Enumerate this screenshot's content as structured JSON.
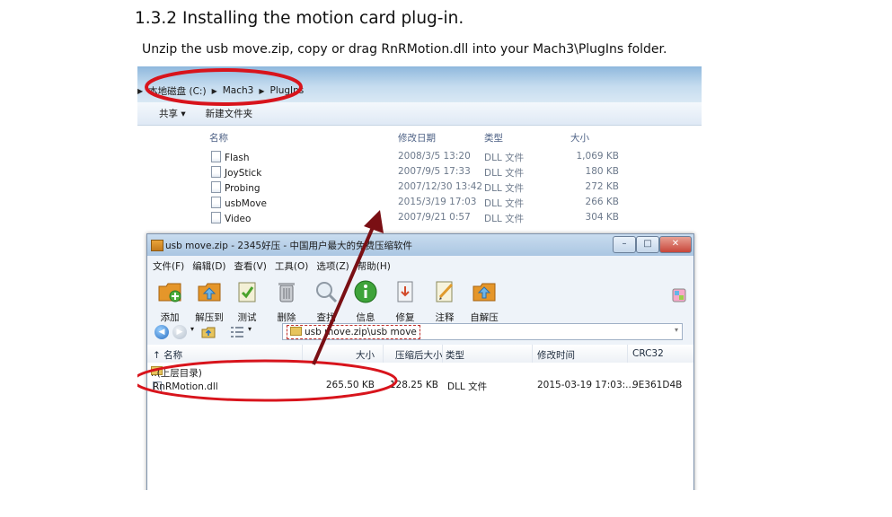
{
  "heading": "1.3.2 Installing the motion card plug-in.",
  "instruction": "Unzip the usb move.zip, copy or drag RnRMotion.dll into your Mach3\\PlugIns folder.",
  "explorer": {
    "breadcrumb": [
      "本地磁盘 (C:)",
      "Mach3",
      "PlugIns"
    ],
    "toolbar": {
      "share": "共享 ▾",
      "new_folder": "新建文件夹"
    },
    "columns": {
      "name": "名称",
      "date": "修改日期",
      "type": "类型",
      "size": "大小"
    },
    "files": [
      {
        "name": "Flash",
        "date": "2008/3/5 13:20",
        "type": "DLL 文件",
        "size": "1,069 KB"
      },
      {
        "name": "JoyStick",
        "date": "2007/9/5 17:33",
        "type": "DLL 文件",
        "size": "180 KB"
      },
      {
        "name": "Probing",
        "date": "2007/12/30 13:42",
        "type": "DLL 文件",
        "size": "272 KB"
      },
      {
        "name": "usbMove",
        "date": "2015/3/19 17:03",
        "type": "DLL 文件",
        "size": "266 KB"
      },
      {
        "name": "Video",
        "date": "2007/9/21 0:57",
        "type": "DLL 文件",
        "size": "304 KB"
      }
    ]
  },
  "zip_window": {
    "title": "usb move.zip - 2345好压 - 中国用户最大的免费压缩软件",
    "menu": [
      "文件(F)",
      "编辑(D)",
      "查看(V)",
      "工具(O)",
      "选项(Z)",
      "帮助(H)"
    ],
    "toolbar": [
      {
        "label": "添加",
        "icon": "add-icon",
        "color": "#e5962a"
      },
      {
        "label": "解压到",
        "icon": "extract-to-icon",
        "color": "#e5962a"
      },
      {
        "label": "测试",
        "icon": "test-icon",
        "color": "#5aa832"
      },
      {
        "label": "删除",
        "icon": "delete-icon",
        "color": "#8a8f96"
      },
      {
        "label": "查找",
        "icon": "search-icon",
        "color": "#9aa4ad"
      },
      {
        "label": "信息",
        "icon": "info-icon",
        "color": "#3ea33a"
      },
      {
        "label": "修复",
        "icon": "repair-icon",
        "color": "#8a8f96"
      },
      {
        "label": "注释",
        "icon": "comment-icon",
        "color": "#6caa3c"
      },
      {
        "label": "自解压",
        "icon": "self-extract-icon",
        "color": "#e5962a"
      }
    ],
    "address": "usb move.zip\\usb move",
    "columns": {
      "name": "↑ 名称",
      "size": "大小",
      "packed": "压缩后大小",
      "type": "类型",
      "modified": "修改时间",
      "crc": "CRC32"
    },
    "parent_row": "..(上层目录)",
    "rows": [
      {
        "name": "RnRMotion.dll",
        "size": "265.50 KB",
        "packed": "128.25 KB",
        "type": "DLL 文件",
        "modified": "2015-03-19 17:03:...",
        "crc": "9E361D4B"
      }
    ]
  },
  "annotation_color": "#d8141c",
  "arrow_color": "#7a0f14"
}
